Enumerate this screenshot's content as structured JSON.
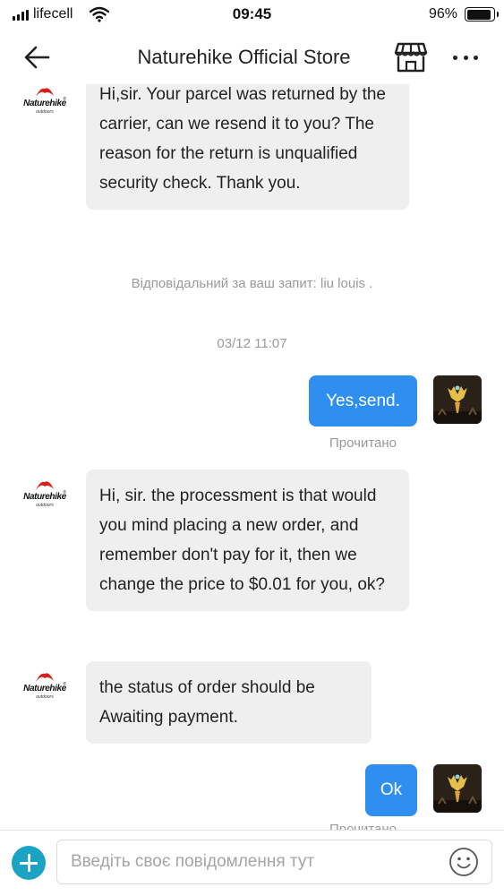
{
  "status_bar": {
    "carrier": "lifecell",
    "time": "09:45",
    "battery_percent": "96%",
    "battery_level": 0.96
  },
  "header": {
    "title": "Naturehike Official Store",
    "icons": [
      "back-arrow-icon",
      "store-icon",
      "more-icon"
    ]
  },
  "brand": {
    "name": "Naturehike",
    "tagline": "outdoors",
    "logo_color": "#d7201b"
  },
  "messages": {
    "m1_text": "Hi,sir. Your parcel was returned by the carrier, can we resend it to you? The reason for the return is unqualified security check. Thank you.",
    "system_note": "Відповідальний за ваш запит: liu louis .",
    "timestamp": "03/12 11:07",
    "m2_text": "Yes,send.",
    "m2_status": "Прочитано",
    "m3_text": "Hi, sir. the processment is that would you mind placing a new order, and remember don't pay for it, then we change the price to $0.01 for you, ok?",
    "m4_text": "the status of order should be Awaiting payment.",
    "m5_text": "Ok",
    "m5_status": "Прочитано"
  },
  "input": {
    "placeholder": "Введіть своє повідомлення тут",
    "value": ""
  },
  "colors": {
    "accent": "#2e8ff0",
    "incoming_bubble": "#efefef",
    "plus_button": "#1aa3c3",
    "muted_text": "#9a9a9a"
  }
}
